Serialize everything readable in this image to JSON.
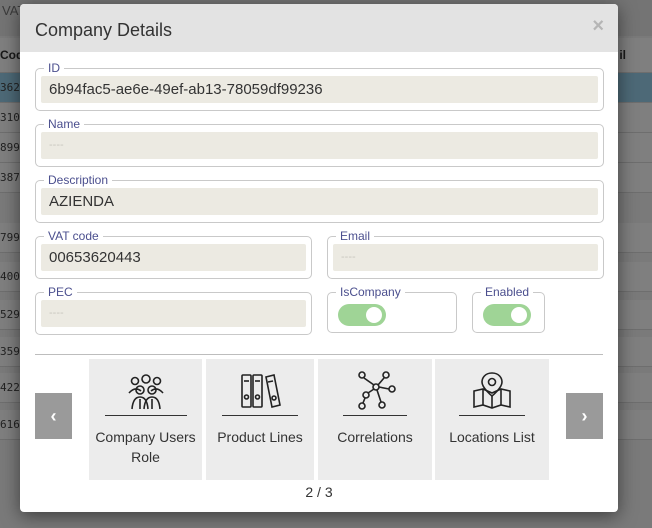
{
  "background": {
    "toolbar_text": "VAT",
    "header_code": "Cod",
    "header_email": "il",
    "rows": [
      "362",
      "310",
      "899",
      "387",
      "799",
      "400",
      "529",
      "359",
      "422",
      "616"
    ]
  },
  "modal": {
    "title": "Company Details",
    "close_symbol": "×",
    "fields": {
      "id": {
        "label": "ID",
        "value": "6b94fac5-ae6e-49ef-ab13-78059df99236"
      },
      "name": {
        "label": "Name",
        "value": "----"
      },
      "description": {
        "label": "Description",
        "value": "AZIENDA"
      },
      "vat_code": {
        "label": "VAT code",
        "value": "00653620443"
      },
      "email": {
        "label": "Email",
        "value": "----"
      },
      "pec": {
        "label": "PEC",
        "value": "----"
      },
      "is_company": {
        "label": "IsCompany",
        "checked": true
      },
      "enabled": {
        "label": "Enabled",
        "checked": true
      }
    },
    "carousel": {
      "prev_symbol": "‹",
      "next_symbol": "›",
      "cards": [
        {
          "label": "Company Users Role",
          "icon": "users-group-icon"
        },
        {
          "label": "Product Lines",
          "icon": "binders-icon"
        },
        {
          "label": "Correlations",
          "icon": "network-nodes-icon"
        },
        {
          "label": "Locations List",
          "icon": "map-pin-icon"
        }
      ],
      "page_indicator": "2 / 3"
    },
    "colors": {
      "header_bg": "#e3e3e3",
      "label_color": "#4b4f8e",
      "field_bg": "#eceae2",
      "toggle_on": "#9fd496",
      "card_bg": "#ececec",
      "nav_button_bg": "#9a9a9a"
    }
  }
}
